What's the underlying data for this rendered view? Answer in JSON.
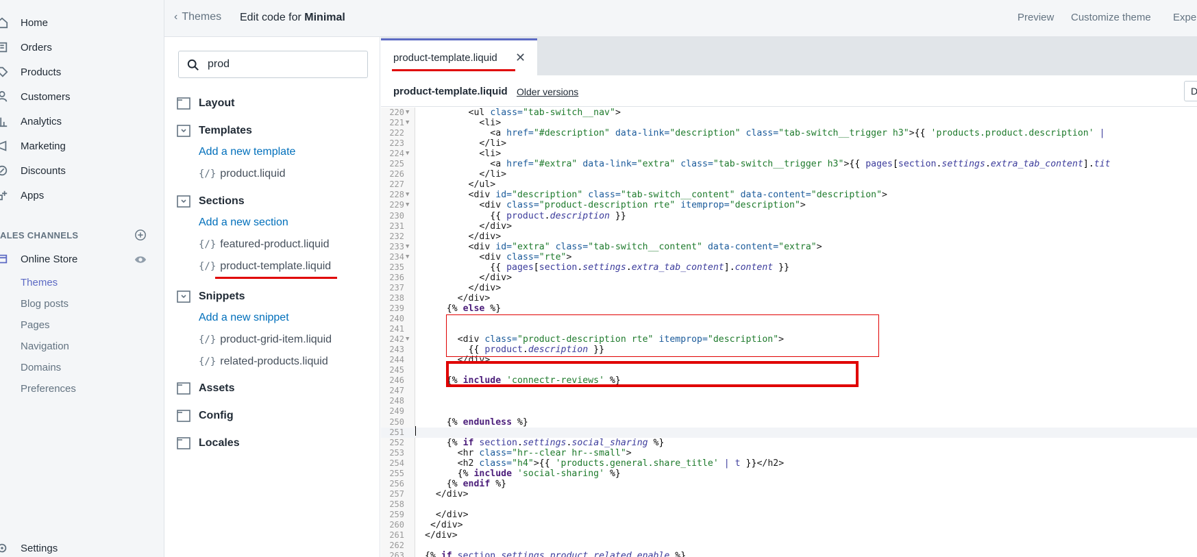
{
  "nav": {
    "items": [
      {
        "label": "Home",
        "icon": "home-icon"
      },
      {
        "label": "Orders",
        "icon": "orders-icon"
      },
      {
        "label": "Products",
        "icon": "products-icon"
      },
      {
        "label": "Customers",
        "icon": "customers-icon"
      },
      {
        "label": "Analytics",
        "icon": "analytics-icon"
      },
      {
        "label": "Marketing",
        "icon": "marketing-icon"
      },
      {
        "label": "Discounts",
        "icon": "discounts-icon"
      },
      {
        "label": "Apps",
        "icon": "apps-icon"
      }
    ],
    "sales_channels_label": "ALES CHANNELS",
    "online_store_label": "Online Store",
    "sub_items": [
      "Themes",
      "Blog posts",
      "Pages",
      "Navigation",
      "Domains",
      "Preferences"
    ],
    "active_sub_item": "Themes",
    "settings_label": "Settings"
  },
  "topbar": {
    "back_label": "Themes",
    "edit_prefix": "Edit code for ",
    "theme_name": "Minimal",
    "preview_label": "Preview",
    "customize_label": "Customize theme",
    "expert_label": "Expe"
  },
  "file_browser": {
    "search_value": "prod",
    "layout_label": "Layout",
    "templates_label": "Templates",
    "add_template_label": "Add a new template",
    "template_files": [
      "product.liquid"
    ],
    "sections_label": "Sections",
    "add_section_label": "Add a new section",
    "section_files": [
      "featured-product.liquid",
      "product-template.liquid"
    ],
    "snippets_label": "Snippets",
    "add_snippet_label": "Add a new snippet",
    "snippet_files": [
      "product-grid-item.liquid",
      "related-products.liquid"
    ],
    "assets_label": "Assets",
    "config_label": "Config",
    "locales_label": "Locales",
    "liquid_glyph": "{/}"
  },
  "editor": {
    "tab_label": "product-template.liquid",
    "close_glyph": "✕",
    "file_name": "product-template.liquid",
    "older_versions_label": "Older versions",
    "header_button_label": "D",
    "lines": [
      {
        "n": "220",
        "fold": true,
        "html": "        <span class='tag'>&lt;ul</span> <span class='attr'>class=</span><span class='str'>\"tab-switch__nav\"</span><span class='tag'>&gt;</span>"
      },
      {
        "n": "221",
        "fold": true,
        "html": "          <span class='tag'>&lt;li&gt;</span>"
      },
      {
        "n": "222",
        "fold": false,
        "html": "            <span class='tag'>&lt;a</span> <span class='attr'>href=</span><span class='str'>\"#description\"</span> <span class='attr'>data-link=</span><span class='str'>\"description\"</span> <span class='attr'>class=</span><span class='str'>\"tab-switch__trigger h3\"</span><span class='tag'>&gt;</span>{{ <span class='str'>'products.product.description'</span> <span class='pipe'>|</span>"
      },
      {
        "n": "223",
        "fold": false,
        "html": "          <span class='tag'>&lt;/li&gt;</span>"
      },
      {
        "n": "224",
        "fold": true,
        "html": "          <span class='tag'>&lt;li&gt;</span>"
      },
      {
        "n": "225",
        "fold": false,
        "html": "            <span class='tag'>&lt;a</span> <span class='attr'>href=</span><span class='str'>\"#extra\"</span> <span class='attr'>data-link=</span><span class='str'>\"extra\"</span> <span class='attr'>class=</span><span class='str'>\"tab-switch__trigger h3\"</span><span class='tag'>&gt;</span>{{ <span class='var'>pages</span>[<span class='var'>section</span>.<span class='prop'>settings</span>.<span class='prop'>extra_tab_content</span>].<span class='prop'>tit</span>"
      },
      {
        "n": "226",
        "fold": false,
        "html": "          <span class='tag'>&lt;/li&gt;</span>"
      },
      {
        "n": "227",
        "fold": false,
        "html": "        <span class='tag'>&lt;/ul&gt;</span>"
      },
      {
        "n": "228",
        "fold": true,
        "html": "        <span class='tag'>&lt;div</span> <span class='attr'>id=</span><span class='str'>\"description\"</span> <span class='attr'>class=</span><span class='str'>\"tab-switch__content\"</span> <span class='attr'>data-content=</span><span class='str'>\"description\"</span><span class='tag'>&gt;</span>"
      },
      {
        "n": "229",
        "fold": true,
        "html": "          <span class='tag'>&lt;div</span> <span class='attr'>class=</span><span class='str'>\"product-description rte\"</span> <span class='attr'>itemprop=</span><span class='str'>\"description\"</span><span class='tag'>&gt;</span>"
      },
      {
        "n": "230",
        "fold": false,
        "html": "            {{ <span class='var'>product</span>.<span class='prop'>description</span> }}"
      },
      {
        "n": "231",
        "fold": false,
        "html": "          <span class='tag'>&lt;/div&gt;</span>"
      },
      {
        "n": "232",
        "fold": false,
        "html": "        <span class='tag'>&lt;/div&gt;</span>"
      },
      {
        "n": "233",
        "fold": true,
        "html": "        <span class='tag'>&lt;div</span> <span class='attr'>id=</span><span class='str'>\"extra\"</span> <span class='attr'>class=</span><span class='str'>\"tab-switch__content\"</span> <span class='attr'>data-content=</span><span class='str'>\"extra\"</span><span class='tag'>&gt;</span>"
      },
      {
        "n": "234",
        "fold": true,
        "html": "          <span class='tag'>&lt;div</span> <span class='attr'>class=</span><span class='str'>\"rte\"</span><span class='tag'>&gt;</span>"
      },
      {
        "n": "235",
        "fold": false,
        "html": "            {{ <span class='var'>pages</span>[<span class='var'>section</span>.<span class='prop'>settings</span>.<span class='prop'>extra_tab_content</span>].<span class='prop'>content</span> }}"
      },
      {
        "n": "236",
        "fold": false,
        "html": "          <span class='tag'>&lt;/div&gt;</span>"
      },
      {
        "n": "237",
        "fold": false,
        "html": "        <span class='tag'>&lt;/div&gt;</span>"
      },
      {
        "n": "238",
        "fold": false,
        "html": "      <span class='tag'>&lt;/div&gt;</span>"
      },
      {
        "n": "239",
        "fold": false,
        "html": "    {% <span class='kw'>else</span> %}"
      },
      {
        "n": "240",
        "fold": false,
        "html": ""
      },
      {
        "n": "241",
        "fold": false,
        "html": ""
      },
      {
        "n": "242",
        "fold": true,
        "html": "      <span class='tag'>&lt;div</span> <span class='attr'>class=</span><span class='str'>\"product-description rte\"</span> <span class='attr'>itemprop=</span><span class='str'>\"description\"</span><span class='tag'>&gt;</span>"
      },
      {
        "n": "243",
        "fold": false,
        "html": "        {{ <span class='var'>product</span>.<span class='prop'>description</span> }}"
      },
      {
        "n": "244",
        "fold": false,
        "html": "      <span class='tag'>&lt;/div&gt;</span>"
      },
      {
        "n": "245",
        "fold": false,
        "html": ""
      },
      {
        "n": "246",
        "fold": false,
        "html": "    {% <span class='kw'>include</span> <span class='str'>'connectr-reviews'</span> %}"
      },
      {
        "n": "247",
        "fold": false,
        "html": ""
      },
      {
        "n": "248",
        "fold": false,
        "html": ""
      },
      {
        "n": "249",
        "fold": false,
        "html": ""
      },
      {
        "n": "250",
        "fold": false,
        "html": "    {% <span class='kw'>endunless</span> %}"
      },
      {
        "n": "251",
        "fold": false,
        "html": "",
        "current": true
      },
      {
        "n": "252",
        "fold": false,
        "html": "    {% <span class='kw'>if</span> <span class='var'>section</span>.<span class='prop'>settings</span>.<span class='prop'>social_sharing</span> %}"
      },
      {
        "n": "253",
        "fold": false,
        "html": "      <span class='tag'>&lt;hr</span> <span class='attr'>class=</span><span class='str'>\"hr--clear hr--small\"</span><span class='tag'>&gt;</span>"
      },
      {
        "n": "254",
        "fold": false,
        "html": "      <span class='tag'>&lt;h2</span> <span class='attr'>class=</span><span class='str'>\"h4\"</span><span class='tag'>&gt;</span>{{ <span class='str'>'products.general.share_title'</span> <span class='pipe'>|</span> <span class='var'>t</span> }}<span class='tag'>&lt;/h2&gt;</span>"
      },
      {
        "n": "255",
        "fold": false,
        "html": "      {% <span class='kw'>include</span> <span class='str'>'social-sharing'</span> %}"
      },
      {
        "n": "256",
        "fold": false,
        "html": "    {% <span class='kw'>endif</span> %}"
      },
      {
        "n": "257",
        "fold": false,
        "html": "  <span class='tag'>&lt;/div&gt;</span>"
      },
      {
        "n": "258",
        "fold": false,
        "html": ""
      },
      {
        "n": "259",
        "fold": false,
        "html": "  <span class='tag'>&lt;/div&gt;</span>"
      },
      {
        "n": "260",
        "fold": false,
        "html": " <span class='tag'>&lt;/div&gt;</span>"
      },
      {
        "n": "261",
        "fold": false,
        "html": "<span class='tag'>&lt;/div&gt;</span>"
      },
      {
        "n": "262",
        "fold": false,
        "html": ""
      },
      {
        "n": "263",
        "fold": false,
        "html": "{% <span class='kw'>if</span> <span class='var'>section</span>.<span class='prop'>settings</span>.<span class='prop'>product_related_enable</span> %}"
      }
    ]
  },
  "colors": {
    "accent": "#5c6ac4",
    "link": "#006fbb",
    "annotation_red": "#e00000"
  }
}
